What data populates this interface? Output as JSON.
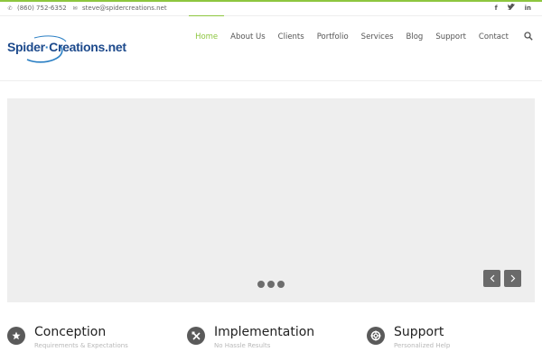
{
  "topbar": {
    "phone": "(860) 752-6352",
    "email": "steve@spidercreations.net",
    "social": [
      "facebook-icon",
      "twitter-icon",
      "linkedin-icon"
    ]
  },
  "logo": {
    "part1": "Spider",
    "part2": "Creations.net"
  },
  "nav": {
    "items": [
      {
        "label": "Home",
        "active": true
      },
      {
        "label": "About Us"
      },
      {
        "label": "Clients"
      },
      {
        "label": "Portfolio"
      },
      {
        "label": "Services"
      },
      {
        "label": "Blog"
      },
      {
        "label": "Support"
      },
      {
        "label": "Contact"
      }
    ],
    "search_icon": "search-icon"
  },
  "slider": {
    "dots": 3,
    "prev_icon": "chevron-left-icon",
    "next_icon": "chevron-right-icon"
  },
  "features": [
    {
      "title": "Conception",
      "subtitle": "Requirements & Expectations",
      "icon": "star-icon"
    },
    {
      "title": "Implementation",
      "subtitle": "No Hassle Results",
      "icon": "tools-icon"
    },
    {
      "title": "Support",
      "subtitle": "Personalized Help",
      "icon": "lifebuoy-icon"
    }
  ],
  "colors": {
    "accent": "#8dc63f",
    "logo_blue": "#1d4a8c",
    "slider_bg": "#eeeeee"
  }
}
